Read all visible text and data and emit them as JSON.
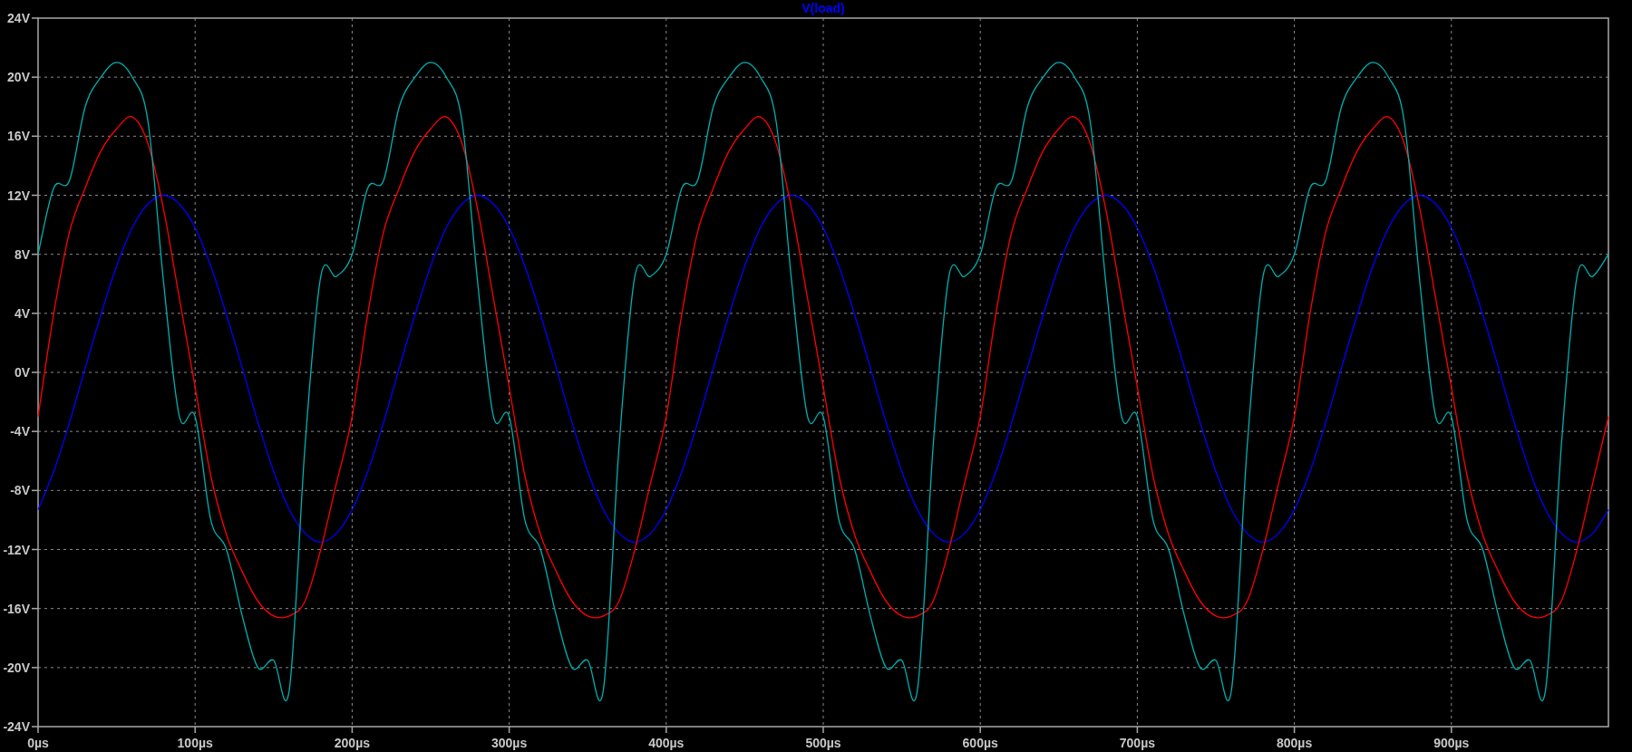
{
  "chart_data": {
    "type": "line",
    "x": [
      0,
      10,
      20,
      30,
      40,
      50,
      60,
      70,
      80,
      90,
      100,
      110,
      120,
      130,
      140,
      150,
      160,
      170,
      180,
      190,
      200,
      210,
      220,
      230,
      240,
      250,
      260,
      270,
      280,
      290,
      300,
      310,
      320,
      330,
      340,
      350,
      360,
      370,
      380,
      390,
      400,
      410,
      420,
      430,
      440,
      450,
      460,
      470,
      480,
      490,
      500,
      510,
      520,
      530,
      540,
      550,
      560,
      570,
      580,
      590,
      600,
      610,
      620,
      630,
      640,
      650,
      660,
      670,
      680,
      690,
      700,
      710,
      720,
      730,
      740,
      750,
      760,
      770,
      780,
      790,
      800,
      810,
      820,
      830,
      840,
      850,
      860,
      870,
      880,
      890,
      900,
      910,
      920,
      930,
      940,
      950,
      960,
      970,
      980,
      990,
      1000
    ],
    "series": [
      {
        "name": "V(load)",
        "color": "#0000ff",
        "values": [
          -9.3,
          -6.7,
          -3.4,
          0.3,
          3.9,
          7.2,
          9.8,
          11.4,
          12,
          11.4,
          9.8,
          7.2,
          3.9,
          0.3,
          -3.4,
          -6.7,
          -9.3,
          -10.9,
          -11.5,
          -10.9,
          -9.3,
          -6.7,
          -3.4,
          0.3,
          3.9,
          7.2,
          9.8,
          11.4,
          12,
          11.4,
          9.8,
          7.2,
          3.9,
          0.3,
          -3.4,
          -6.7,
          -9.3,
          -10.9,
          -11.5,
          -10.9,
          -9.3,
          -6.7,
          -3.4,
          0.3,
          3.9,
          7.2,
          9.8,
          11.4,
          12,
          11.4,
          9.8,
          7.2,
          3.9,
          0.3,
          -3.4,
          -6.7,
          -9.3,
          -10.9,
          -11.5,
          -10.9,
          -9.3,
          -6.7,
          -3.4,
          0.3,
          3.9,
          7.2,
          9.8,
          11.4,
          12,
          11.4,
          9.8,
          7.2,
          3.9,
          0.3,
          -3.4,
          -6.7,
          -9.3,
          -10.9,
          -11.5,
          -10.9,
          -9.3,
          -6.7,
          -3.4,
          0.3,
          3.9,
          7.2,
          9.8,
          11.4,
          12,
          11.4,
          9.8,
          7.2,
          3.9,
          0.3,
          -3.4,
          -6.7,
          -9.3,
          -10.9,
          -11.5,
          -10.9,
          -9.3
        ]
      },
      {
        "color": "#ff0000",
        "values": [
          -3,
          4,
          9.5,
          12.5,
          15,
          16.5,
          17.3,
          15.5,
          11,
          5,
          -1,
          -7,
          -11,
          -13.5,
          -15.5,
          -16.5,
          -16.5,
          -15.5,
          -12,
          -7.5,
          -3,
          4,
          9.5,
          12.5,
          15,
          16.5,
          17.3,
          15.5,
          11,
          5,
          -1,
          -7,
          -11,
          -13.5,
          -15.5,
          -16.5,
          -16.5,
          -15.5,
          -12,
          -7.5,
          -3,
          4,
          9.5,
          12.5,
          15,
          16.5,
          17.3,
          15.5,
          11,
          5,
          -1,
          -7,
          -11,
          -13.5,
          -15.5,
          -16.5,
          -16.5,
          -15.5,
          -12,
          -7.5,
          -3,
          4,
          9.5,
          12.5,
          15,
          16.5,
          17.3,
          15.5,
          11,
          5,
          -1,
          -7,
          -11,
          -13.5,
          -15.5,
          -16.5,
          -16.5,
          -15.5,
          -12,
          -7.5,
          -3,
          4,
          9.5,
          12.5,
          15,
          16.5,
          17.3,
          15.5,
          11,
          5,
          -1,
          -7,
          -11,
          -13.5,
          -15.5,
          -16.5,
          -16.5,
          -15.5,
          -12,
          -7.5,
          -3
        ]
      },
      {
        "color": "#00b0b0",
        "values": [
          8,
          12.5,
          13,
          18,
          20,
          21,
          20,
          17,
          6,
          -3,
          -3,
          -10,
          -12,
          -16.5,
          -20,
          -19.5,
          -21.5,
          -5,
          6.5,
          6.5,
          8,
          12.5,
          13,
          18,
          20,
          21,
          20,
          17,
          6,
          -3,
          -3,
          -10,
          -12,
          -16.5,
          -20,
          -19.5,
          -21.5,
          -5,
          6.5,
          6.5,
          8,
          12.5,
          13,
          18,
          20,
          21,
          20,
          17,
          6,
          -3,
          -3,
          -10,
          -12,
          -16.5,
          -20,
          -19.5,
          -21.5,
          -5,
          6.5,
          6.5,
          8,
          12.5,
          13,
          18,
          20,
          21,
          20,
          17,
          6,
          -3,
          -3,
          -10,
          -12,
          -16.5,
          -20,
          -19.5,
          -21.5,
          -5,
          6.5,
          6.5,
          8,
          12.5,
          13,
          18,
          20,
          21,
          20,
          17,
          6,
          -3,
          -3,
          -10,
          -12,
          -16.5,
          -20,
          -19.5,
          -21.5,
          -5,
          6.5,
          6.5,
          8
        ]
      }
    ],
    "xlim": [
      0,
      1000
    ],
    "ylim": [
      -24,
      24
    ],
    "grid": true,
    "xticks": [
      {
        "value": 0,
        "label": "0µs"
      },
      {
        "value": 100,
        "label": "100µs"
      },
      {
        "value": 200,
        "label": "200µs"
      },
      {
        "value": 300,
        "label": "300µs"
      },
      {
        "value": 400,
        "label": "400µs"
      },
      {
        "value": 500,
        "label": "500µs"
      },
      {
        "value": 600,
        "label": "600µs"
      },
      {
        "value": 700,
        "label": "700µs"
      },
      {
        "value": 800,
        "label": "800µs"
      },
      {
        "value": 900,
        "label": "900µs"
      }
    ],
    "yticks": [
      {
        "value": 24,
        "label": "24V"
      },
      {
        "value": 20,
        "label": "20V"
      },
      {
        "value": 16,
        "label": "16V"
      },
      {
        "value": 12,
        "label": "12V"
      },
      {
        "value": 8,
        "label": "8V"
      },
      {
        "value": 4,
        "label": "4V"
      },
      {
        "value": 0,
        "label": "0V"
      },
      {
        "value": -4,
        "label": "-4V"
      },
      {
        "value": -8,
        "label": "-8V"
      },
      {
        "value": -12,
        "label": "-12V"
      },
      {
        "value": -16,
        "label": "-16V"
      },
      {
        "value": -20,
        "label": "-20V"
      },
      {
        "value": -24,
        "label": "-24V"
      }
    ]
  }
}
